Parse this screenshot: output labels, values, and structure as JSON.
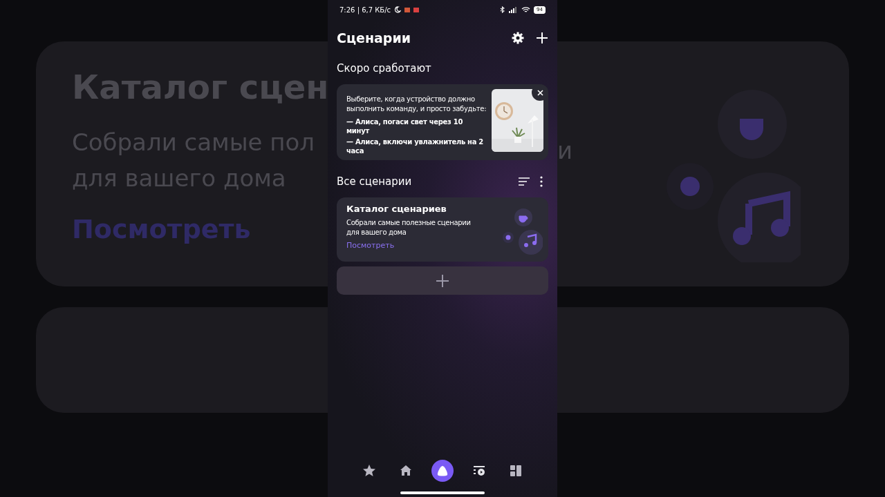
{
  "backdrop": {
    "left_texts": {
      "title": "Каталог сцен",
      "line_1": "Собрали самые пол",
      "line_2": "для вашего дома",
      "link": "Посмотреть"
    },
    "right_texts": {
      "line_1": "и"
    }
  },
  "status_bar": {
    "time": "7:26 | 6,7 КБ/с",
    "battery": "94"
  },
  "header": {
    "title": "Сценарии"
  },
  "soon": {
    "title": "Скоро сработают",
    "text": "Выберите, когда устройство должно выполнить команду, и просто забудьте:",
    "examples": [
      "— Алиса, погаси свет через 10 минут",
      "— Алиса, включи увлажнитель на 2 часа"
    ]
  },
  "all": {
    "title": "Все сценарии",
    "catalog": {
      "title": "Каталог сценариев",
      "text": "Собрали самые полезные сценарии для вашего дома",
      "link": "Посмотреть"
    }
  },
  "nav": [
    {
      "kind": "star",
      "selected": false
    },
    {
      "kind": "home",
      "selected": false
    },
    {
      "kind": "alice",
      "selected": true
    },
    {
      "kind": "scenarios",
      "selected": false
    },
    {
      "kind": "devices",
      "selected": false
    }
  ]
}
